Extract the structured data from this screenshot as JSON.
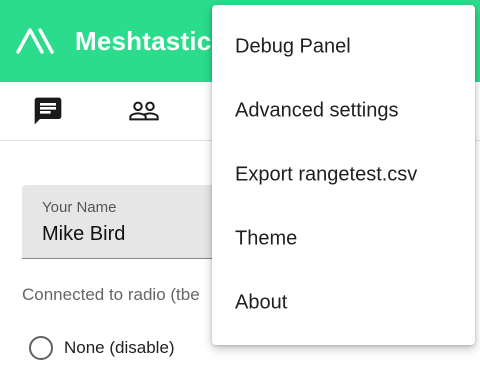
{
  "app": {
    "title": "Meshtastic",
    "brand_color": "#2bdc8c",
    "logo_icon": "meshtastic-logo-icon"
  },
  "tabs": [
    {
      "icon": "chat-icon"
    },
    {
      "icon": "people-icon"
    }
  ],
  "settings": {
    "name_label": "Your Name",
    "name_value": "Mike Bird",
    "connected_text": "Connected to radio (tbe",
    "radio_option_label": "None (disable)"
  },
  "overflow_menu": {
    "items": [
      {
        "label": "Debug Panel"
      },
      {
        "label": "Advanced settings"
      },
      {
        "label": "Export rangetest.csv"
      },
      {
        "label": "Theme"
      },
      {
        "label": "About"
      }
    ]
  }
}
